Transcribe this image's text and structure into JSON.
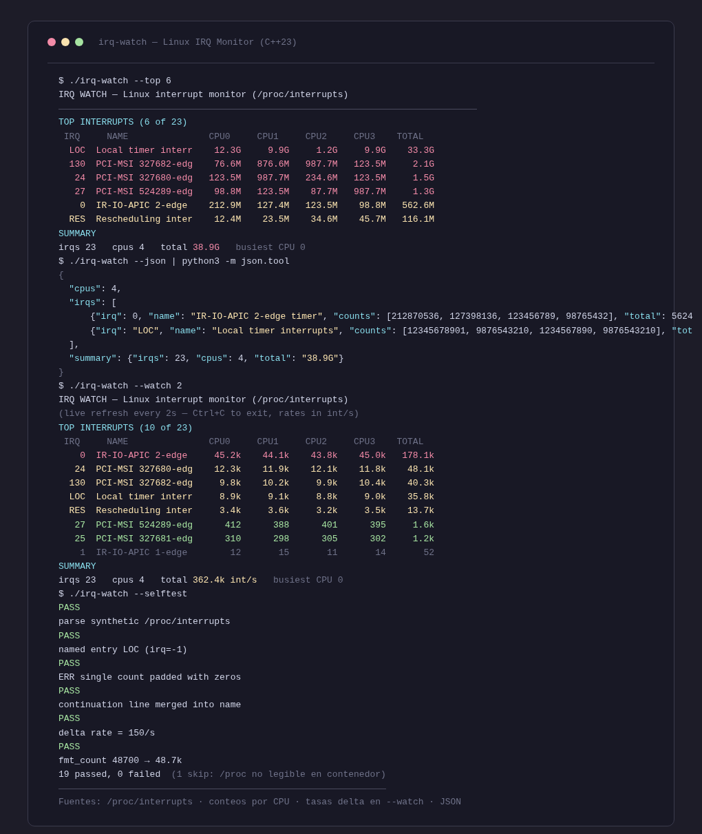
{
  "window": {
    "title": "irq-watch — Linux IRQ Monitor (C++23)"
  },
  "terminal": {
    "lines": [
      {
        "kind": "command",
        "text": "$ ./irq-watch --top 6"
      },
      {
        "kind": "text",
        "text": "IRQ WATCH — Linux interrupt monitor (/proc/interrupts)"
      },
      {
        "kind": "rule"
      },
      {
        "kind": "heading",
        "text": "TOP INTERRUPTS (6 of 23)"
      },
      {
        "kind": "table",
        "columns": [
          "IRQ",
          "NAME",
          "CPU0",
          "CPU1",
          "CPU2",
          "CPU3",
          "TOTAL"
        ],
        "rows": [
          {
            "irq": "LOC",
            "name": "Local timer interr",
            "cpus": [
              "12.3G",
              "9.9G",
              "1.2G",
              "9.9G"
            ],
            "total": "33.3G",
            "color": "#f38ba8"
          },
          {
            "irq": "130",
            "name": "PCI-MSI 327682-edg",
            "cpus": [
              "76.6M",
              "876.6M",
              "987.7M",
              "123.5M"
            ],
            "total": "2.1G",
            "color": "#f38ba8"
          },
          {
            "irq": "24",
            "name": "PCI-MSI 327680-edg",
            "cpus": [
              "123.5M",
              "987.7M",
              "234.6M",
              "123.5M"
            ],
            "total": "1.5G",
            "color": "#f38ba8"
          },
          {
            "irq": "27",
            "name": "PCI-MSI 524289-edg",
            "cpus": [
              "98.8M",
              "123.5M",
              "87.7M",
              "987.7M"
            ],
            "total": "1.3G",
            "color": "#f38ba8"
          },
          {
            "irq": "0",
            "name": "IR-IO-APIC 2-edge",
            "cpus": [
              "212.9M",
              "127.4M",
              "123.5M",
              "98.8M"
            ],
            "total": "562.6M",
            "color": "#f9e2af"
          },
          {
            "irq": "RES",
            "name": "Rescheduling inter",
            "cpus": [
              "12.4M",
              "23.5M",
              "34.6M",
              "45.7M"
            ],
            "total": "116.1M",
            "color": "#f9e2af"
          }
        ]
      },
      {
        "kind": "heading",
        "text": "SUMMARY"
      },
      {
        "kind": "summary",
        "irqs": "irqs 23",
        "cpus": "cpus 4",
        "total_label": "total",
        "total": {
          "text": "38.9G",
          "color": "#f38ba8"
        },
        "busiest": "busiest CPU 0"
      },
      {
        "kind": "command",
        "text": "$ ./irq-watch --json | python3 -m json.tool"
      },
      {
        "kind": "json",
        "lines": [
          {
            "segments": [
              {
                "text": "{",
                "kind": "punct"
              }
            ],
            "children": [
              {
                "segments": [
                  {
                    "text": "\"cpus\"",
                    "kind": "key"
                  },
                  {
                    "text": ": 4,",
                    "kind": "plain"
                  }
                ]
              },
              {
                "segments": [
                  {
                    "text": "\"irqs\"",
                    "kind": "key"
                  },
                  {
                    "text": ": [",
                    "kind": "plain"
                  }
                ],
                "children": [
                  {
                    "segments": [
                      {
                        "text": "{",
                        "kind": "plain"
                      },
                      {
                        "text": "\"irq\"",
                        "kind": "key"
                      },
                      {
                        "text": ": 0, ",
                        "kind": "plain"
                      },
                      {
                        "text": "\"name\"",
                        "kind": "key"
                      },
                      {
                        "text": ": ",
                        "kind": "plain"
                      },
                      {
                        "text": "\"IR-IO-APIC 2-edge timer\"",
                        "kind": "string"
                      },
                      {
                        "text": ", ",
                        "kind": "plain"
                      },
                      {
                        "text": "\"counts\"",
                        "kind": "key"
                      },
                      {
                        "text": ": [212870536, 127398136, 123456789, 98765432], ",
                        "kind": "plain"
                      },
                      {
                        "text": "\"total\"",
                        "kind": "key"
                      },
                      {
                        "text": ": 5624",
                        "kind": "plain"
                      }
                    ]
                  },
                  {
                    "segments": [
                      {
                        "text": "{",
                        "kind": "plain"
                      },
                      {
                        "text": "\"irq\"",
                        "kind": "key"
                      },
                      {
                        "text": ": ",
                        "kind": "plain"
                      },
                      {
                        "text": "\"LOC\"",
                        "kind": "string"
                      },
                      {
                        "text": ", ",
                        "kind": "plain"
                      },
                      {
                        "text": "\"name\"",
                        "kind": "key"
                      },
                      {
                        "text": ": ",
                        "kind": "plain"
                      },
                      {
                        "text": "\"Local timer interrupts\"",
                        "kind": "string"
                      },
                      {
                        "text": ", ",
                        "kind": "plain"
                      },
                      {
                        "text": "\"counts\"",
                        "kind": "key"
                      },
                      {
                        "text": ": [12345678901, 9876543210, 1234567890, 9876543210], ",
                        "kind": "plain"
                      },
                      {
                        "text": "\"tot",
                        "kind": "key"
                      }
                    ]
                  }
                ]
              },
              {
                "segments": [
                  {
                    "text": "],",
                    "kind": "plain"
                  }
                ]
              },
              {
                "segments": [
                  {
                    "text": "\"summary\"",
                    "kind": "key"
                  },
                  {
                    "text": ": {",
                    "kind": "plain"
                  },
                  {
                    "text": "\"irqs\"",
                    "kind": "key"
                  },
                  {
                    "text": ": 23, ",
                    "kind": "plain"
                  },
                  {
                    "text": "\"cpus\"",
                    "kind": "key"
                  },
                  {
                    "text": ": 4, ",
                    "kind": "plain"
                  },
                  {
                    "text": "\"total\"",
                    "kind": "key"
                  },
                  {
                    "text": ": ",
                    "kind": "plain"
                  },
                  {
                    "text": "\"38.9G\"",
                    "kind": "string"
                  },
                  {
                    "text": "}",
                    "kind": "plain"
                  }
                ]
              }
            ]
          },
          {
            "segments": [
              {
                "text": "}",
                "kind": "punct"
              }
            ]
          }
        ]
      },
      {
        "kind": "command",
        "text": "$ ./irq-watch --watch 2"
      },
      {
        "kind": "text",
        "text": "IRQ WATCH — Linux interrupt monitor (/proc/interrupts)"
      },
      {
        "kind": "dim",
        "text": "(live refresh every 2s — Ctrl+C to exit, rates in int/s)"
      },
      {
        "kind": "heading",
        "text": "TOP INTERRUPTS (10 of 23)"
      },
      {
        "kind": "table",
        "columns": [
          "IRQ",
          "NAME",
          "CPU0",
          "CPU1",
          "CPU2",
          "CPU3",
          "TOTAL"
        ],
        "rows": [
          {
            "irq": "0",
            "name": "IR-IO-APIC 2-edge",
            "cpus": [
              "45.2k",
              "44.1k",
              "43.8k",
              "45.0k"
            ],
            "total": "178.1k",
            "color": "#f38ba8"
          },
          {
            "irq": "24",
            "name": "PCI-MSI 327680-edg",
            "cpus": [
              "12.3k",
              "11.9k",
              "12.1k",
              "11.8k"
            ],
            "total": "48.1k",
            "color": "#f9e2af"
          },
          {
            "irq": "130",
            "name": "PCI-MSI 327682-edg",
            "cpus": [
              "9.8k",
              "10.2k",
              "9.9k",
              "10.4k"
            ],
            "total": "40.3k",
            "color": "#f9e2af"
          },
          {
            "irq": "LOC",
            "name": "Local timer interr",
            "cpus": [
              "8.9k",
              "9.1k",
              "8.8k",
              "9.0k"
            ],
            "total": "35.8k",
            "color": "#f9e2af"
          },
          {
            "irq": "RES",
            "name": "Rescheduling inter",
            "cpus": [
              "3.4k",
              "3.6k",
              "3.2k",
              "3.5k"
            ],
            "total": "13.7k",
            "color": "#f9e2af"
          },
          {
            "irq": "27",
            "name": "PCI-MSI 524289-edg",
            "cpus": [
              "412",
              "388",
              "401",
              "395"
            ],
            "total": "1.6k",
            "color": "#a6e3a1"
          },
          {
            "irq": "25",
            "name": "PCI-MSI 327681-edg",
            "cpus": [
              "310",
              "298",
              "305",
              "302"
            ],
            "total": "1.2k",
            "color": "#a6e3a1"
          },
          {
            "irq": "1",
            "name": "IR-IO-APIC 1-edge",
            "cpus": [
              "12",
              "15",
              "11",
              "14"
            ],
            "total": "52",
            "color": "#6f7289"
          }
        ]
      },
      {
        "kind": "heading",
        "text": "SUMMARY"
      },
      {
        "kind": "summary",
        "irqs": "irqs 23",
        "cpus": "cpus 4",
        "total_label": "total",
        "total": {
          "text": "362.4k int/s",
          "color": "#f9e2af"
        },
        "busiest": "busiest CPU 0"
      },
      {
        "kind": "command",
        "text": "$ ./irq-watch --selftest"
      },
      {
        "kind": "pass",
        "text": "PASS"
      },
      {
        "kind": "text",
        "text": "parse synthetic /proc/interrupts"
      },
      {
        "kind": "pass",
        "text": "PASS"
      },
      {
        "kind": "text",
        "text": "named entry LOC (irq=-1)"
      },
      {
        "kind": "pass",
        "text": "PASS"
      },
      {
        "kind": "text",
        "text": "ERR single count padded with zeros"
      },
      {
        "kind": "pass",
        "text": "PASS"
      },
      {
        "kind": "text",
        "text": "continuation line merged into name"
      },
      {
        "kind": "pass",
        "text": "PASS"
      },
      {
        "kind": "text",
        "text": "delta rate = 150/s"
      },
      {
        "kind": "pass",
        "text": "PASS"
      },
      {
        "kind": "text",
        "text": "fmt_count 48700 → 48.7k"
      },
      {
        "kind": "result",
        "text": "19 passed, 0 failed",
        "note": "(1 skip: /proc no legible en contenedor)"
      },
      {
        "kind": "rule-short"
      },
      {
        "kind": "footer",
        "text": "Fuentes: /proc/interrupts · conteos por CPU · tasas delta en --watch · JSON"
      }
    ]
  }
}
